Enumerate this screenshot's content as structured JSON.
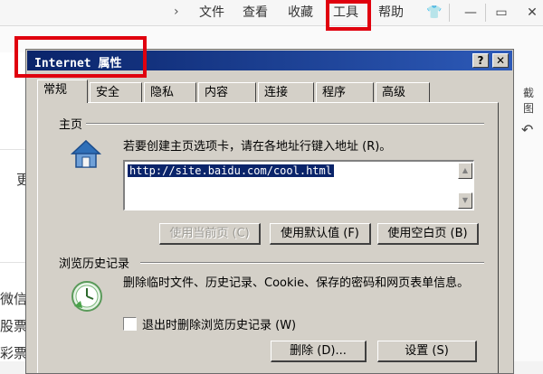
{
  "browser": {
    "menu": {
      "chevron": "›",
      "file": "文件",
      "view": "查看",
      "favorites": "收藏",
      "tools": "工具",
      "help": "帮助"
    },
    "window_buttons": {
      "skin": "👕",
      "minimize": "—",
      "maximize": "▭",
      "close": "✕"
    },
    "background_fragments": {
      "left_1": "更",
      "left_2": "微信",
      "left_3": "股票",
      "left_4": "彩票",
      "right_1": "截图",
      "right_2": "↶"
    }
  },
  "dialog": {
    "title": "Internet 属性",
    "help_button": "?",
    "close_button": "✕",
    "tabs": [
      "常规",
      "安全",
      "隐私",
      "内容",
      "连接",
      "程序",
      "高级"
    ],
    "active_tab": "常规",
    "home_page": {
      "group_label": "主页",
      "hint": "若要创建主页选项卡，请在各地址行键入地址 (R)。",
      "url": "http://site.baidu.com/cool.html",
      "scroll_up": "▲",
      "scroll_down": "▼",
      "use_current": "使用当前页 (C)",
      "use_default": "使用默认值 (F)",
      "use_blank": "使用空白页 (B)"
    },
    "browsing_history": {
      "group_label": "浏览历史记录",
      "description": "删除临时文件、历史记录、Cookie、保存的密码和网页表单信息。",
      "delete_on_exit": "退出时删除浏览历史记录 (W)",
      "delete_button": "删除 (D)...",
      "settings_button": "设置 (S)"
    }
  },
  "colors": {
    "highlight": "#e0000e",
    "titlebar_start": "#0a246a",
    "titlebar_end": "#2d5ab8",
    "dialog_face": "#d4d0c8"
  }
}
